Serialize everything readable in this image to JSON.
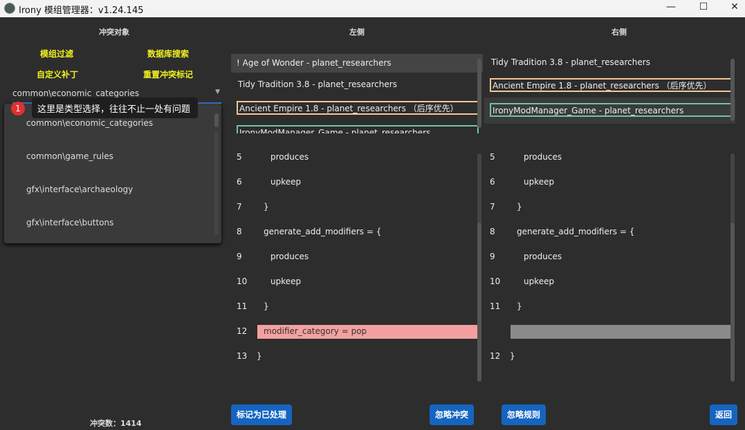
{
  "window": {
    "title": "Irony 模组管理器：v1.24.145",
    "min": "—",
    "max": "☐",
    "close": "✕"
  },
  "left_panel": {
    "header": "冲突对象",
    "links": [
      "模组过滤",
      "数据库搜索",
      "自定义补丁",
      "重置冲突标记"
    ],
    "type_select": {
      "value": "common\\economic_categories",
      "options": [
        "common\\economic_categories",
        "common\\game_rules",
        "gfx\\interface\\archaeology",
        "gfx\\interface\\buttons"
      ]
    },
    "tooltip": {
      "badge": "1",
      "text": "这里是类型选择，往往不止一处有问题"
    },
    "conflict_count": "冲突数：1414"
  },
  "left": {
    "header": "左侧",
    "mods": [
      "! Age of Wonder - planet_researchers",
      "Tidy Tradition 3.8 - planet_researchers",
      "Ancient Empire 1.8 - planet_researchers （后序优先）",
      "IronyModManager_Game - planet_researchers"
    ],
    "lines": [
      {
        "n": "5",
        "t": "produces",
        "i": 2
      },
      {
        "n": "6",
        "t": "upkeep",
        "i": 2
      },
      {
        "n": "7",
        "t": "}",
        "i": 1
      },
      {
        "n": "8",
        "t": "generate_add_modifiers = {",
        "i": 1
      },
      {
        "n": "9",
        "t": "produces",
        "i": 2
      },
      {
        "n": "10",
        "t": "upkeep",
        "i": 2
      },
      {
        "n": "11",
        "t": "}",
        "i": 1
      },
      {
        "n": "12",
        "t": "modifier_category = pop",
        "i": 1,
        "hl": "#f4a0a0"
      },
      {
        "n": "13",
        "t": "}",
        "i": 0
      }
    ]
  },
  "right": {
    "header": "右侧",
    "mods": [
      "Tidy Tradition 3.8 - planet_researchers",
      "Ancient Empire 1.8 - planet_researchers （后序优先）",
      "IronyModManager_Game - planet_researchers"
    ],
    "lines": [
      {
        "n": "5",
        "t": "produces",
        "i": 2
      },
      {
        "n": "6",
        "t": "upkeep",
        "i": 2
      },
      {
        "n": "7",
        "t": "}",
        "i": 1
      },
      {
        "n": "8",
        "t": "generate_add_modifiers = {",
        "i": 1
      },
      {
        "n": "9",
        "t": "produces",
        "i": 2
      },
      {
        "n": "10",
        "t": "upkeep",
        "i": 2
      },
      {
        "n": "11",
        "t": "}",
        "i": 1
      },
      {
        "n": "",
        "t": "",
        "i": 1,
        "hl": "#8a8a8a"
      },
      {
        "n": "12",
        "t": "}",
        "i": 0
      }
    ]
  },
  "buttons": {
    "mark_resolved": "标记为已处理",
    "ignore_conflict": "忽略冲突",
    "ignore_rules": "忽略规则",
    "back": "返回"
  }
}
